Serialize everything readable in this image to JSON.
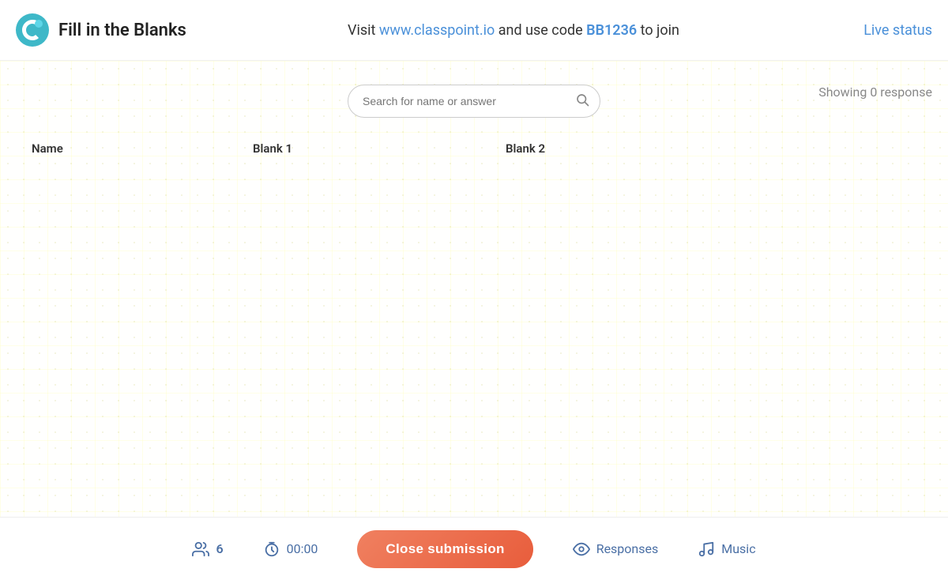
{
  "header": {
    "title": "Fill in the Blanks",
    "visit_text": "Visit",
    "url": "www.classpoint.io",
    "use_code_text": "and use code",
    "code": "BB1236",
    "to_join_text": "to join",
    "live_status": "Live status"
  },
  "search": {
    "placeholder": "Search for name or answer"
  },
  "response": {
    "showing_label": "Showing 0 response"
  },
  "table": {
    "columns": [
      {
        "label": "Name"
      },
      {
        "label": "Blank 1"
      },
      {
        "label": "Blank 2"
      }
    ]
  },
  "bottom_bar": {
    "participant_count": "6",
    "timer": "00:00",
    "close_submission": "Close submission",
    "responses": "Responses",
    "music": "Music"
  }
}
